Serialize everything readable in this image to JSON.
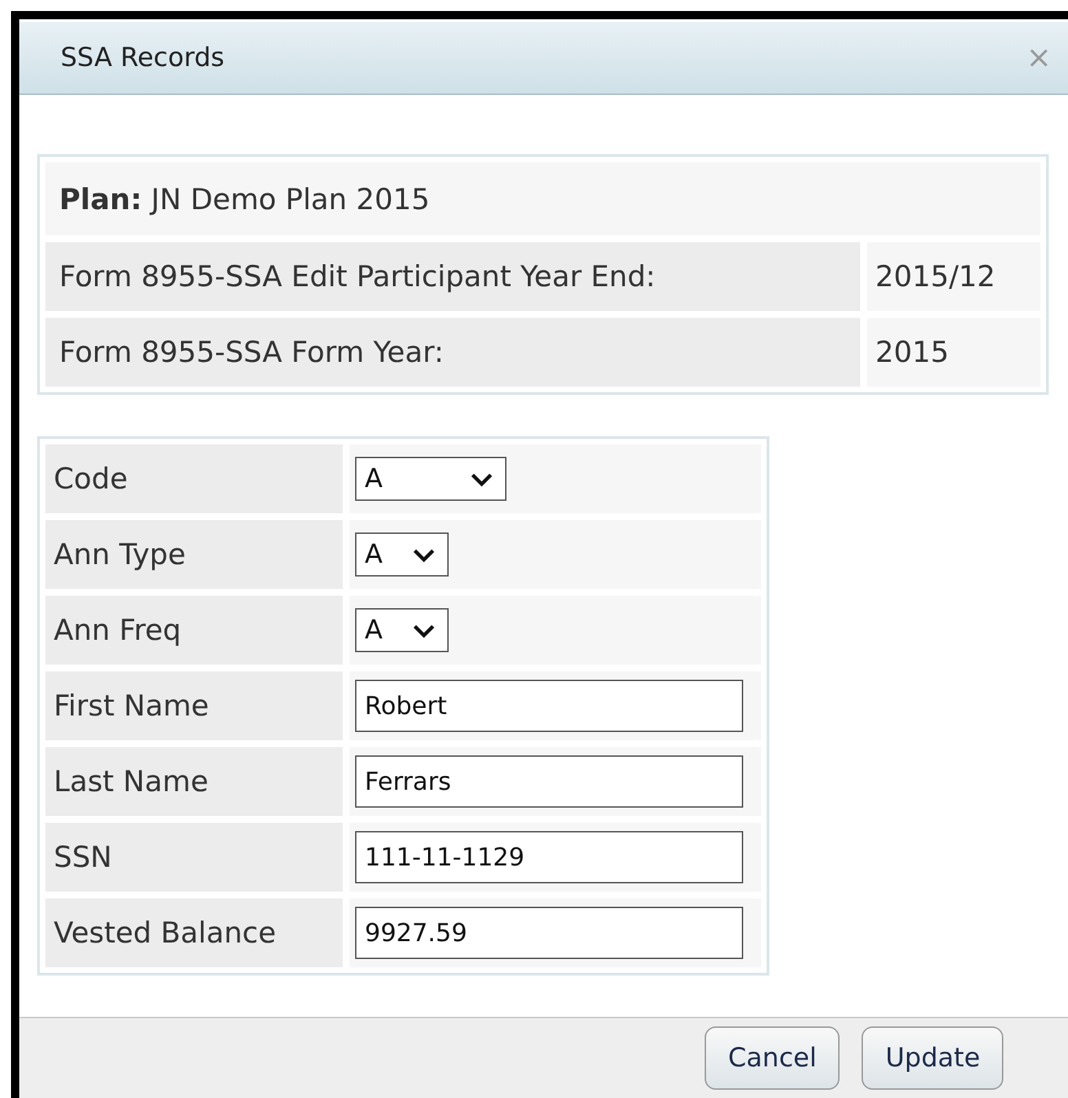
{
  "dialog": {
    "title": "SSA Records",
    "close": "×"
  },
  "info": {
    "plan": "**Plan:** JN Demo Plan 2015",
    "rows": [
      {
        "label": "Form 8955-SSA Edit Participant Year End:",
        "value": "2015/12"
      },
      {
        "label": "Form 8955-SSA Form Year:",
        "value": "2015"
      }
    ]
  },
  "fields": [
    {
      "label": "Code",
      "kind": "select",
      "value": "A",
      "wide": true
    },
    {
      "label": "Ann Type",
      "kind": "select",
      "value": "A",
      "wide": false
    },
    {
      "label": "Ann Freq",
      "kind": "select",
      "value": "A",
      "wide": false
    },
    {
      "label": "First Name",
      "kind": "text",
      "value": "Robert"
    },
    {
      "label": "Last Name",
      "kind": "text",
      "value": "Ferrars"
    },
    {
      "label": "SSN",
      "kind": "text",
      "value": "111-11-1129"
    },
    {
      "label": "Vested Balance",
      "kind": "text",
      "value": "9927.59"
    }
  ],
  "buttons": [
    "Cancel",
    "Update"
  ]
}
